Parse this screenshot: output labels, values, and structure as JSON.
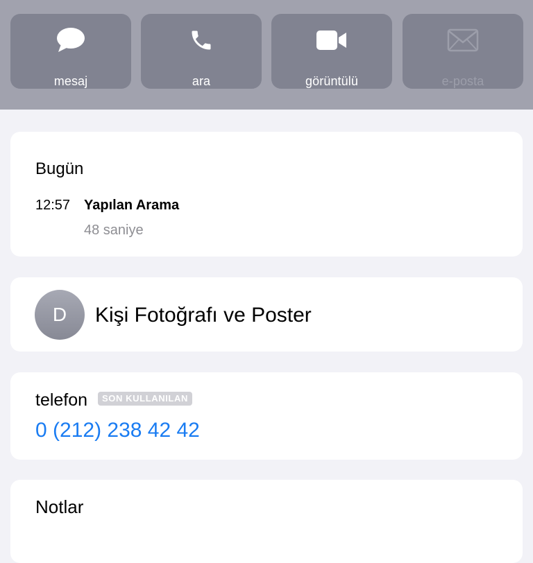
{
  "actions": [
    {
      "label": "mesaj",
      "icon": "message-bubble-icon",
      "enabled": true
    },
    {
      "label": "ara",
      "icon": "phone-icon",
      "enabled": true
    },
    {
      "label": "görüntülü",
      "icon": "video-camera-icon",
      "enabled": true
    },
    {
      "label": "e-posta",
      "icon": "envelope-icon",
      "enabled": false
    }
  ],
  "recents": {
    "day": "Bugün",
    "time": "12:57",
    "type": "Yapılan Arama",
    "duration": "48 saniye"
  },
  "contact_photo": {
    "initial": "D",
    "label": "Kişi Fotoğrafı ve Poster"
  },
  "phone": {
    "label": "telefon",
    "badge": "SON KULLANILAN",
    "number": "0 (212) 238 42 42"
  },
  "notes": {
    "title": "Notlar"
  },
  "colors": {
    "header_bg": "#a1a2ae",
    "action_bg": "#818391",
    "link_blue": "#1a7cf2",
    "page_bg": "#f2f2f7"
  }
}
